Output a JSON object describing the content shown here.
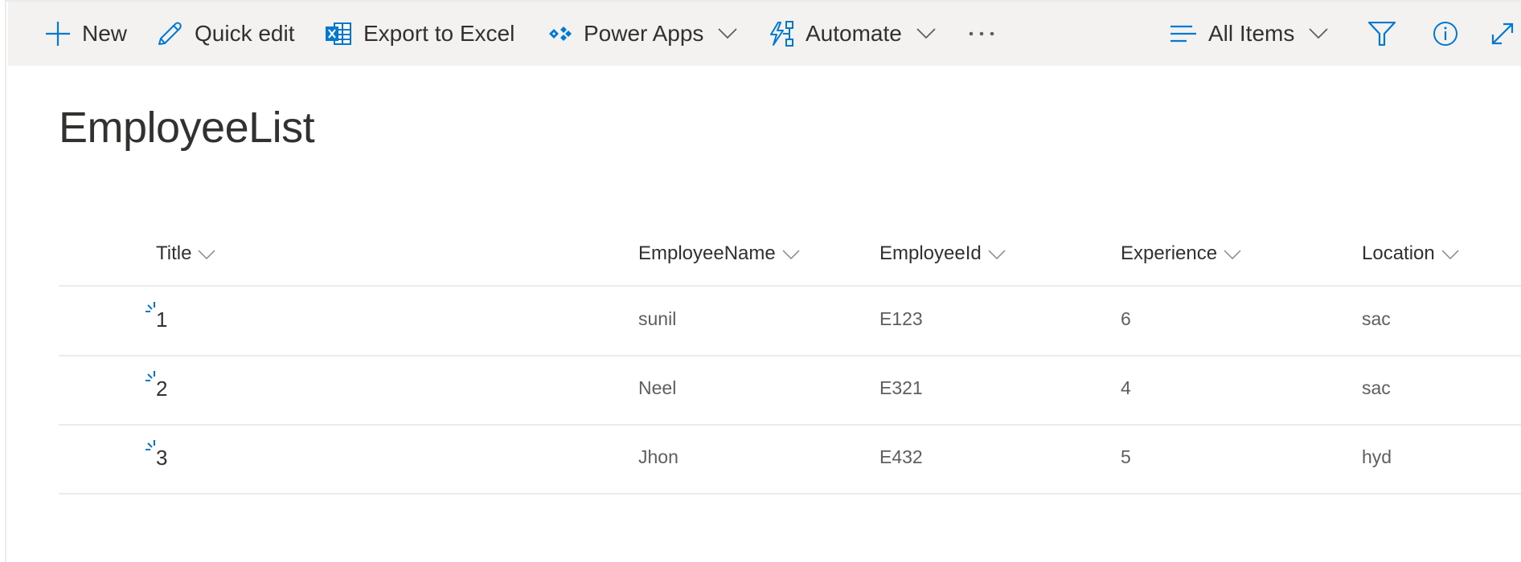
{
  "command_bar": {
    "new": "New",
    "quick_edit": "Quick edit",
    "export": "Export to Excel",
    "power_apps": "Power Apps",
    "automate": "Automate",
    "more": "···",
    "view": "All Items"
  },
  "list": {
    "title": "EmployeeList",
    "columns": [
      "Title",
      "EmployeeName",
      "EmployeeId",
      "Experience",
      "Location"
    ],
    "rows": [
      {
        "title": "1",
        "employee_name": "sunil",
        "employee_id": "E123",
        "experience": "6",
        "location": "sac",
        "is_new": true
      },
      {
        "title": "2",
        "employee_name": "Neel",
        "employee_id": "E321",
        "experience": "4",
        "location": "sac",
        "is_new": true
      },
      {
        "title": "3",
        "employee_name": "Jhon",
        "employee_id": "E432",
        "experience": "5",
        "location": "hyd",
        "is_new": true
      }
    ]
  },
  "colors": {
    "accent": "#0078d4",
    "command_bar_bg": "#f3f2f1",
    "text_primary": "#323130",
    "text_secondary": "#605e5c",
    "divider": "#edebe9"
  }
}
